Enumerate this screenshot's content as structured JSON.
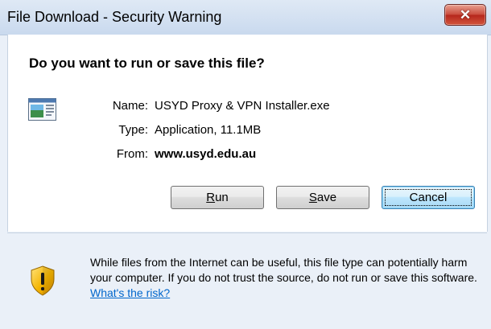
{
  "window": {
    "title": "File Download - Security Warning"
  },
  "dialog": {
    "question": "Do you want to run or save this file?",
    "fields": {
      "name_label": "Name:",
      "name_value": "USYD Proxy & VPN Installer.exe",
      "type_label": "Type:",
      "type_value": "Application, 11.1MB",
      "from_label": "From:",
      "from_value": "www.usyd.edu.au"
    },
    "buttons": {
      "run": {
        "mnemonic": "R",
        "rest": "un"
      },
      "save": {
        "mnemonic": "S",
        "rest": "ave"
      },
      "cancel": "Cancel"
    }
  },
  "footer": {
    "warning_text": "While files from the Internet can be useful, this file type can potentially harm your computer. If you do not trust the source, do not run or save this software. ",
    "risk_link": "What's the risk?"
  },
  "icons": {
    "close": "close-icon",
    "file": "file-icon",
    "shield": "security-shield-icon"
  },
  "colors": {
    "titlebar": "#c9d9ee",
    "close_button": "#c8493a",
    "link": "#0066cc",
    "footer_bg": "#eaf0f8"
  }
}
